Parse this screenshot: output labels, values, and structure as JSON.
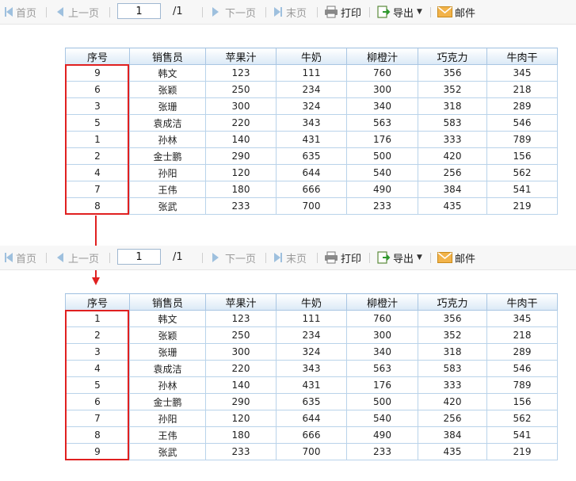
{
  "toolbar": {
    "first": "首页",
    "prev": "上一页",
    "page_value": "1",
    "total": "/1",
    "next": "下一页",
    "last": "末页",
    "print": "打印",
    "export": "导出",
    "mail": "邮件"
  },
  "table": {
    "headers": [
      "序号",
      "销售员",
      "苹果汁",
      "牛奶",
      "柳橙汁",
      "巧克力",
      "牛肉干"
    ]
  },
  "table_before": {
    "rows": [
      [
        "9",
        "韩文",
        "123",
        "111",
        "760",
        "356",
        "345"
      ],
      [
        "6",
        "张颖",
        "250",
        "234",
        "300",
        "352",
        "218"
      ],
      [
        "3",
        "张珊",
        "300",
        "324",
        "340",
        "318",
        "289"
      ],
      [
        "5",
        "袁成洁",
        "220",
        "343",
        "563",
        "583",
        "546"
      ],
      [
        "1",
        "孙林",
        "140",
        "431",
        "176",
        "333",
        "789"
      ],
      [
        "2",
        "金士鹏",
        "290",
        "635",
        "500",
        "420",
        "156"
      ],
      [
        "4",
        "孙阳",
        "120",
        "644",
        "540",
        "256",
        "562"
      ],
      [
        "7",
        "王伟",
        "180",
        "666",
        "490",
        "384",
        "541"
      ],
      [
        "8",
        "张武",
        "233",
        "700",
        "233",
        "435",
        "219"
      ]
    ]
  },
  "table_after": {
    "rows": [
      [
        "1",
        "韩文",
        "123",
        "111",
        "760",
        "356",
        "345"
      ],
      [
        "2",
        "张颖",
        "250",
        "234",
        "300",
        "352",
        "218"
      ],
      [
        "3",
        "张珊",
        "300",
        "324",
        "340",
        "318",
        "289"
      ],
      [
        "4",
        "袁成洁",
        "220",
        "343",
        "563",
        "583",
        "546"
      ],
      [
        "5",
        "孙林",
        "140",
        "431",
        "176",
        "333",
        "789"
      ],
      [
        "6",
        "金士鹏",
        "290",
        "635",
        "500",
        "420",
        "156"
      ],
      [
        "7",
        "孙阳",
        "120",
        "644",
        "540",
        "256",
        "562"
      ],
      [
        "8",
        "王伟",
        "180",
        "666",
        "490",
        "384",
        "541"
      ],
      [
        "9",
        "张武",
        "233",
        "700",
        "233",
        "435",
        "219"
      ]
    ]
  },
  "colors": {
    "highlight": "#e02020",
    "header_border": "#a9c6e3",
    "nav_icon": "#9ec0de"
  },
  "icons": {
    "first": "first-page-icon",
    "prev": "prev-page-icon",
    "next": "next-page-icon",
    "last": "last-page-icon",
    "print": "printer-icon",
    "export": "export-icon",
    "mail": "mail-icon"
  }
}
